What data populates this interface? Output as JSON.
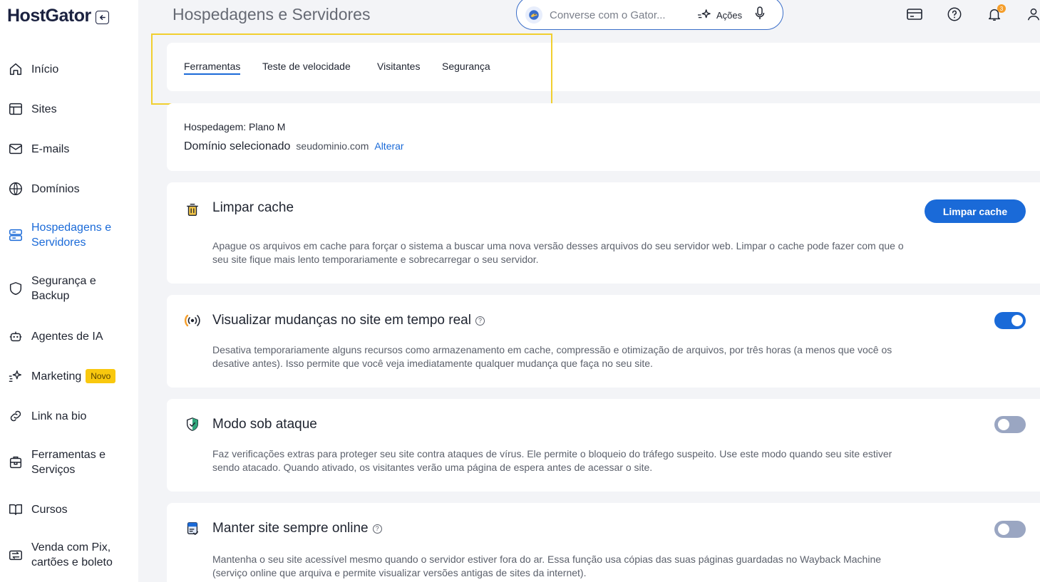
{
  "brand": {
    "logo": "HostGator"
  },
  "header": {
    "title": "Hospedagens e Servidores",
    "search_placeholder": "Converse com o Gator...",
    "actions_label": "Ações",
    "notification_count": "3"
  },
  "sidebar": {
    "items": [
      {
        "label": "Início",
        "icon": "home-icon"
      },
      {
        "label": "Sites",
        "icon": "layout-icon"
      },
      {
        "label": "E-mails",
        "icon": "mail-icon"
      },
      {
        "label": "Domínios",
        "icon": "globe-icon"
      },
      {
        "label": "Hospedagens e Servidores",
        "icon": "server-icon",
        "active": true
      },
      {
        "label": "Segurança e Backup",
        "icon": "shield-icon"
      },
      {
        "label": "Agentes de IA",
        "icon": "robot-icon"
      },
      {
        "label": "Marketing",
        "icon": "sparkle-icon",
        "badge": "Novo"
      },
      {
        "label": "Link na bio",
        "icon": "link-icon"
      },
      {
        "label": "Ferramentas e Serviços",
        "icon": "tools-icon"
      },
      {
        "label": "Cursos",
        "icon": "book-icon"
      },
      {
        "label": "Venda com Pix, cartões e boleto",
        "icon": "exchange-icon"
      }
    ]
  },
  "tabs": [
    {
      "label": "Ferramentas",
      "active": true
    },
    {
      "label": "Teste de velocidade"
    },
    {
      "label": "Visitantes"
    },
    {
      "label": "Segurança"
    }
  ],
  "hosting": {
    "plan": "Hospedagem: Plano M",
    "domain_label": "Domínio selecionado",
    "domain_value": "seudominio.com",
    "change_label": "Alterar"
  },
  "features": [
    {
      "title": "Limpar cache",
      "description": "Apague os arquivos em cache para forçar o sistema a buscar uma nova versão desses arquivos do seu servidor web. Limpar o cache pode fazer com que o seu site fique mais lento temporariamente e sobrecarregar o seu servidor.",
      "button_label": "Limpar cache"
    },
    {
      "title": "Visualizar mudanças no site em tempo real",
      "description": "Desativa temporariamente alguns recursos como armazenamento em cache, compressão e otimização de arquivos, por três horas (a menos que você os desative antes). Isso permite que você veja imediatamente qualquer mudança que faça no seu site.",
      "toggle": "on"
    },
    {
      "title": "Modo sob ataque",
      "description": "Faz verificações extras para proteger seu site contra ataques de vírus. Ele permite o bloqueio do tráfego suspeito. Use este modo quando seu site estiver sendo atacado. Quando ativado, os visitantes verão uma página de espera antes de acessar o site.",
      "toggle": "off"
    },
    {
      "title": "Manter site sempre online",
      "description": "Mantenha o seu site acessível mesmo quando o servidor estiver fora do ar. Essa função usa cópias das suas páginas guardadas no Wayback Machine (serviço online que arquiva e permite visualizar versões antigas de sites da internet).",
      "toggle": "off"
    }
  ],
  "help_glyph": "?",
  "colors": {
    "primary": "#1a6ad8",
    "highlight": "#f1cf2f",
    "badge": "#f9c80e",
    "notification": "#f59e2b"
  }
}
